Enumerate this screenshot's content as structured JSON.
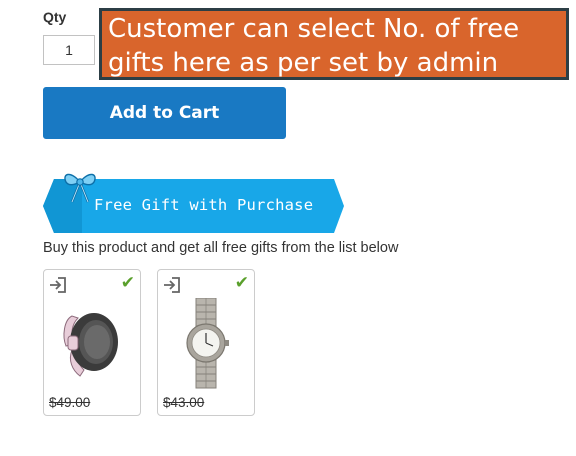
{
  "product": {
    "qty_label": "Qty",
    "qty_value": "1",
    "add_to_cart_label": "Add to Cart"
  },
  "callout": {
    "line1": "Customer can select No. of free",
    "line2": "gifts here as per set by admin"
  },
  "free_gift": {
    "banner_text": "Free Gift with Purchase",
    "description": "Buy this product and get all free gifts from the list below",
    "items": [
      {
        "price": "$49.00",
        "selected": true,
        "icon": "sport-watch"
      },
      {
        "price": "$43.00",
        "selected": true,
        "icon": "steel-watch"
      }
    ]
  },
  "colors": {
    "callout_bg": "#d9652c",
    "button": "#1979c3",
    "banner": "#18a7e8",
    "check": "#5aa02c"
  }
}
